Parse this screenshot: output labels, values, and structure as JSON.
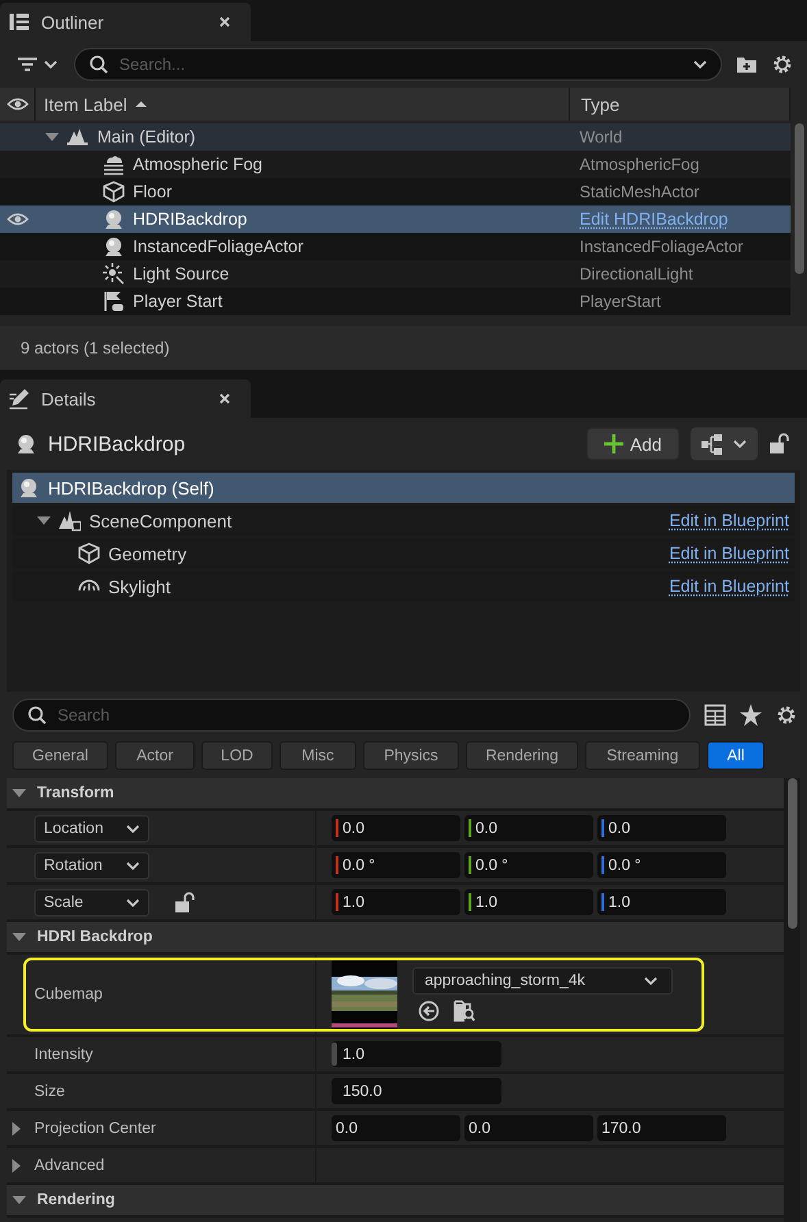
{
  "outliner": {
    "tab": {
      "title": "Outliner"
    },
    "search": {
      "placeholder": "Search..."
    },
    "columns": [
      "Item Label",
      "Type"
    ],
    "rows": [
      {
        "label": "Main (Editor)",
        "type": "World",
        "kind": "world",
        "selected": false,
        "visible": false,
        "expanded": true,
        "children": [
          {
            "label": "Atmospheric Fog",
            "type": "AtmosphericFog",
            "kind": "fog",
            "selected": false,
            "visible": false
          },
          {
            "label": "Floor",
            "type": "StaticMeshActor",
            "kind": "mesh",
            "selected": false,
            "visible": false
          },
          {
            "label": "HDRIBackdrop",
            "type": "Edit HDRIBackdrop",
            "kind": "backdrop",
            "selected": true,
            "visible": true
          },
          {
            "label": "InstancedFoliageActor",
            "type": "InstancedFoliageActor",
            "kind": "backdrop",
            "selected": false,
            "visible": false
          },
          {
            "label": "Light Source",
            "type": "DirectionalLight",
            "kind": "light",
            "selected": false,
            "visible": false
          },
          {
            "label": "Player Start",
            "type": "PlayerStart",
            "kind": "start",
            "selected": false,
            "visible": false
          }
        ]
      }
    ],
    "status": "9 actors (1 selected)"
  },
  "details": {
    "tab": {
      "title": "Details"
    },
    "actor": "HDRIBackdrop",
    "add_button": "Add",
    "components": [
      {
        "label": "HDRIBackdrop (Self)",
        "kind": "actor",
        "selected": true,
        "children": [
          {
            "label": "SceneComponent",
            "kind": "scene",
            "selected": false,
            "expanded": true,
            "link": "Edit in Blueprint",
            "children": [
              {
                "label": "Geometry",
                "kind": "mesh",
                "selected": false,
                "link": "Edit in Blueprint"
              },
              {
                "label": "Skylight",
                "kind": "skylight",
                "selected": false,
                "link": "Edit in Blueprint"
              }
            ]
          }
        ]
      }
    ],
    "search": {
      "placeholder": "Search"
    },
    "filters": [
      {
        "label": "General",
        "selected": false
      },
      {
        "label": "Actor",
        "selected": false
      },
      {
        "label": "LOD",
        "selected": false
      },
      {
        "label": "Misc",
        "selected": false
      },
      {
        "label": "Physics",
        "selected": false
      },
      {
        "label": "Rendering",
        "selected": false
      },
      {
        "label": "Streaming",
        "selected": false
      },
      {
        "label": "All",
        "selected": true
      }
    ],
    "categories": [
      {
        "title": "Transform",
        "expanded": true,
        "rows": [
          {
            "kind": "vector",
            "label": "Location",
            "ratio_locked": null,
            "values": [
              {
                "text": "0.0",
                "color": "#c4321e"
              },
              {
                "text": "0.0",
                "color": "#5fa51e"
              },
              {
                "text": "0.0",
                "color": "#2f6fd6"
              }
            ]
          },
          {
            "kind": "vector",
            "label": "Rotation",
            "ratio_locked": null,
            "values": [
              {
                "text": "0.0 °",
                "color": "#c4321e"
              },
              {
                "text": "0.0 °",
                "color": "#5fa51e"
              },
              {
                "text": "0.0 °",
                "color": "#2f6fd6"
              }
            ]
          },
          {
            "kind": "vector",
            "label": "Scale",
            "ratio_locked": false,
            "values": [
              {
                "text": "1.0",
                "color": "#c4321e"
              },
              {
                "text": "1.0",
                "color": "#5fa51e"
              },
              {
                "text": "1.0",
                "color": "#2f6fd6"
              }
            ]
          }
        ]
      },
      {
        "title": "HDRI Backdrop",
        "expanded": true,
        "rows": [
          {
            "kind": "asset",
            "label": "Cubemap",
            "asset": "approaching_storm_4k",
            "highlighted": true
          },
          {
            "kind": "slider",
            "label": "Intensity",
            "value": "1.0",
            "level": 0.03
          },
          {
            "kind": "number",
            "label": "Size",
            "value": "150.0"
          },
          {
            "kind": "triple",
            "label": "Projection Center",
            "expanded": false,
            "values": [
              {
                "text": "0.0"
              },
              {
                "text": "0.0"
              },
              {
                "text": "170.0"
              }
            ]
          },
          {
            "kind": "group",
            "label": "Advanced",
            "expanded": false
          }
        ]
      },
      {
        "title": "Rendering",
        "expanded": true
      }
    ]
  }
}
